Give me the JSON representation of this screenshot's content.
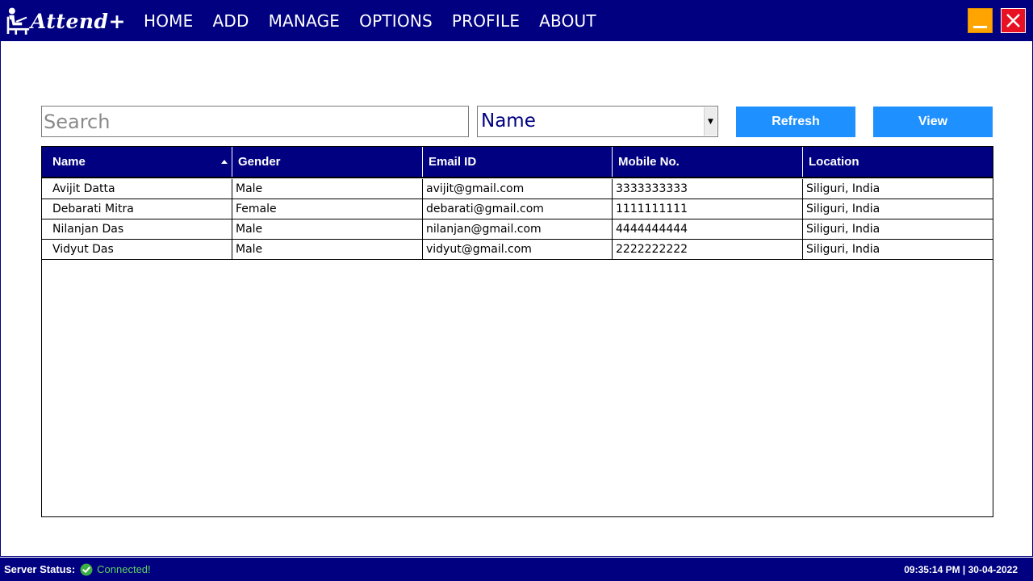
{
  "app": {
    "logo_text": "Attend+",
    "logo_icon": "person-at-desk-icon"
  },
  "nav": {
    "items": [
      {
        "label": "HOME"
      },
      {
        "label": "ADD"
      },
      {
        "label": "MANAGE"
      },
      {
        "label": "OPTIONS"
      },
      {
        "label": "PROFILE"
      },
      {
        "label": "ABOUT"
      }
    ]
  },
  "window_controls": {
    "minimize_icon": "minimize-icon",
    "close_icon": "close-icon",
    "minimize_color": "#ffa400",
    "close_color": "#e81123"
  },
  "toolbar": {
    "search_placeholder": "Search",
    "search_value": "",
    "filter_selected": "Name",
    "refresh_label": "Refresh",
    "view_label": "View",
    "button_color": "#1e90ff"
  },
  "table": {
    "sorted_column": "Name",
    "sort_direction": "ascending",
    "columns": [
      "Name",
      "Gender",
      "Email ID",
      "Mobile No.",
      "Location"
    ],
    "rows": [
      [
        "Avijit Datta",
        "Male",
        "avijit@gmail.com",
        "3333333333",
        "Siliguri, India"
      ],
      [
        "Debarati Mitra",
        "Female",
        "debarati@gmail.com",
        "1111111111",
        "Siliguri, India"
      ],
      [
        "Nilanjan Das",
        "Male",
        "nilanjan@gmail.com",
        "4444444444",
        "Siliguri, India"
      ],
      [
        "Vidyut Das",
        "Male",
        "vidyut@gmail.com",
        "2222222222",
        "Siliguri, India"
      ]
    ]
  },
  "status": {
    "label": "Server Status:",
    "value": "Connected!",
    "icon": "check-circle-icon",
    "value_color": "#5fd35f",
    "datetime": "09:35:14 PM | 30-04-2022"
  },
  "theme": {
    "primary": "#000080",
    "background": "#ffffff"
  }
}
